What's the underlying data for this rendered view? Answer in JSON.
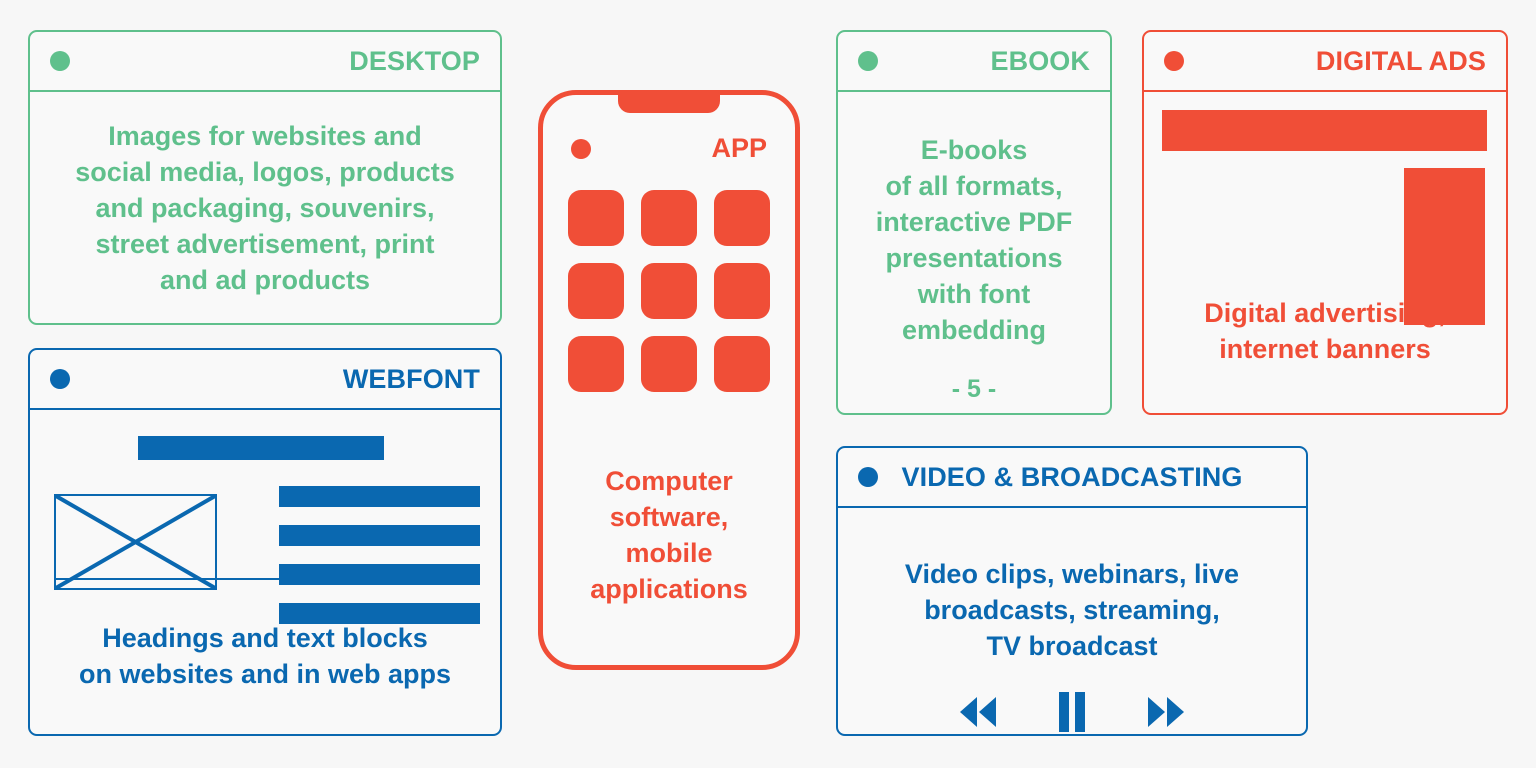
{
  "palette": {
    "green": "#5fc08c",
    "blue": "#0a68b0",
    "red": "#f04e37",
    "background": "#f7f7f7",
    "card_fill": "#f9f9f9"
  },
  "cards": {
    "desktop": {
      "title": "DESKTOP",
      "dot_icon": "status-dot-icon",
      "body": "Images for websites and\nsocial media, logos, products\nand packaging, souvenirs,\nstreet advertisement, print\nand ad products"
    },
    "webfont": {
      "title": "WEBFONT",
      "dot_icon": "status-dot-icon",
      "image_placeholder_icon": "image-placeholder-icon",
      "text_line_count": 4,
      "caption": "Headings and text blocks\non websites and in web apps"
    },
    "app": {
      "title": "APP",
      "dot_icon": "status-dot-icon",
      "app_icon_count": 9,
      "caption": "Computer\nsoftware,\nmobile\napplications"
    },
    "ebook": {
      "title": "EBOOK",
      "dot_icon": "status-dot-icon",
      "body": "E-books\nof all formats,\ninteractive PDF\npresentations\nwith font\nembedding",
      "page_number": "- 5 -"
    },
    "digital_ads": {
      "title": "DIGITAL ADS",
      "dot_icon": "status-dot-icon",
      "banner_leaderboard": "leaderboard-banner",
      "banner_skyscraper": "skyscraper-banner",
      "caption": "Digital advertising,\ninternet banners"
    },
    "video": {
      "title": "VIDEO & BROADCASTING",
      "dot_icon": "status-dot-icon",
      "body": "Video clips, webinars, live\nbroadcasts, streaming,\nTV broadcast",
      "controls": [
        {
          "name": "rewind",
          "icon": "rewind-icon"
        },
        {
          "name": "pause",
          "icon": "pause-icon"
        },
        {
          "name": "fast-forward",
          "icon": "fast-forward-icon"
        }
      ]
    }
  }
}
